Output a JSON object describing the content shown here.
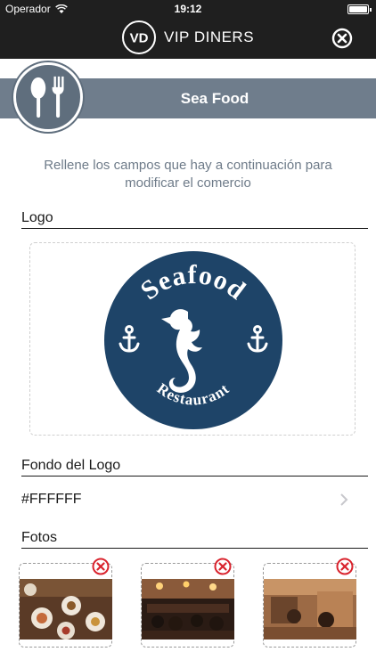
{
  "status_bar": {
    "carrier": "Operador",
    "time": "19:12",
    "battery_level": 1.0
  },
  "header": {
    "brand_name": "VIP DINERS",
    "brand_monogram": "VD"
  },
  "banner": {
    "title": "Sea Food"
  },
  "instructions": "Rellene los campos que hay a continuación para modificar el comercio",
  "logo_section": {
    "label": "Logo",
    "logo_text_top": "Seafood",
    "logo_text_bottom": "Restaurant"
  },
  "logo_background": {
    "label": "Fondo del Logo",
    "value": "#FFFFFF"
  },
  "photos_section": {
    "label": "Fotos",
    "count": 3
  },
  "colors": {
    "bar": "#1f1f1f",
    "banner": "#6f7d8c",
    "accent_red": "#d9232d",
    "logo_navy": "#1e4468"
  }
}
